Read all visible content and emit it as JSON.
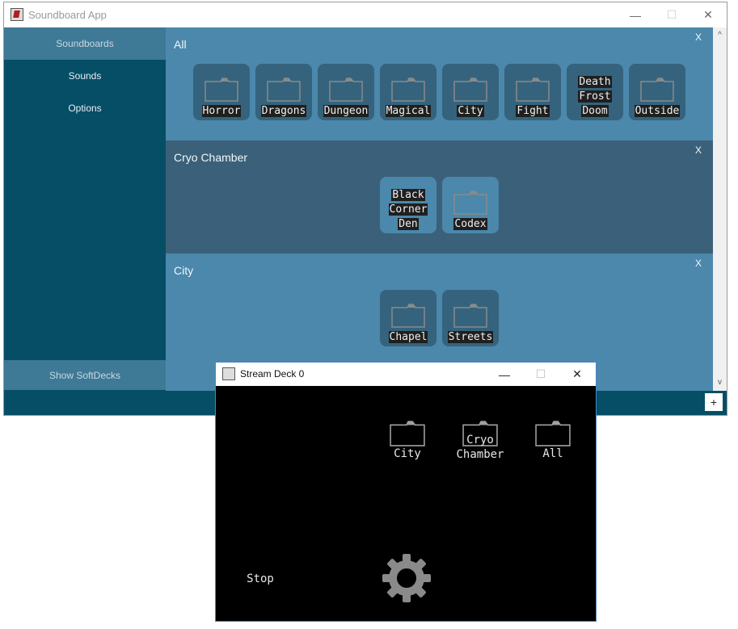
{
  "main_window": {
    "title": "Soundboard App",
    "controls": {
      "minimize": "—",
      "maximize": "☐",
      "close": "✕"
    }
  },
  "sidebar": {
    "items": [
      {
        "label": "Soundboards",
        "active": true
      },
      {
        "label": "Sounds",
        "active": false
      },
      {
        "label": "Options",
        "active": false
      }
    ],
    "show_softdecks": "Show SoftDecks"
  },
  "boards": [
    {
      "name": "All",
      "close": "X",
      "tiles": [
        {
          "label": "Horror",
          "folder": true
        },
        {
          "label": "Dragons",
          "folder": true
        },
        {
          "label": "Dungeon",
          "folder": true
        },
        {
          "label": "Magical",
          "folder": true
        },
        {
          "label": "City",
          "folder": true
        },
        {
          "label": "Fight",
          "folder": true
        },
        {
          "label": "Death Frost Doom",
          "lines": [
            "Death",
            "Frost",
            "Doom"
          ],
          "folder": false
        },
        {
          "label": "Outside",
          "folder": true
        }
      ]
    },
    {
      "name": "Cryo Chamber",
      "close": "X",
      "tiles": [
        {
          "label": "Black Corner Den",
          "lines": [
            "Black",
            "Corner",
            "Den"
          ],
          "folder": false
        },
        {
          "label": "Codex",
          "folder": true
        }
      ]
    },
    {
      "name": "City",
      "close": "X",
      "tiles": [
        {
          "label": "Chapel",
          "folder": true
        },
        {
          "label": "Streets",
          "folder": true
        }
      ]
    }
  ],
  "scrollbar": {
    "up": "^",
    "down": "v"
  },
  "add_button": "+",
  "deck_window": {
    "title": "Stream Deck 0",
    "controls": {
      "minimize": "—",
      "maximize": "☐",
      "close": "✕"
    },
    "keys": [
      {
        "label": "City",
        "lines": [
          "City"
        ]
      },
      {
        "label": "Cryo Chamber",
        "lines": [
          "Cryo",
          "Chamber"
        ]
      },
      {
        "label": "All",
        "lines": [
          "All"
        ]
      }
    ],
    "stop_label": "Stop",
    "settings_icon": "gear-icon"
  },
  "colors": {
    "sidebar": "#054e66",
    "content": "#4b88ab",
    "content_dark": "#3a6179",
    "tile": "#35637d",
    "deck_bg": "#000000"
  }
}
